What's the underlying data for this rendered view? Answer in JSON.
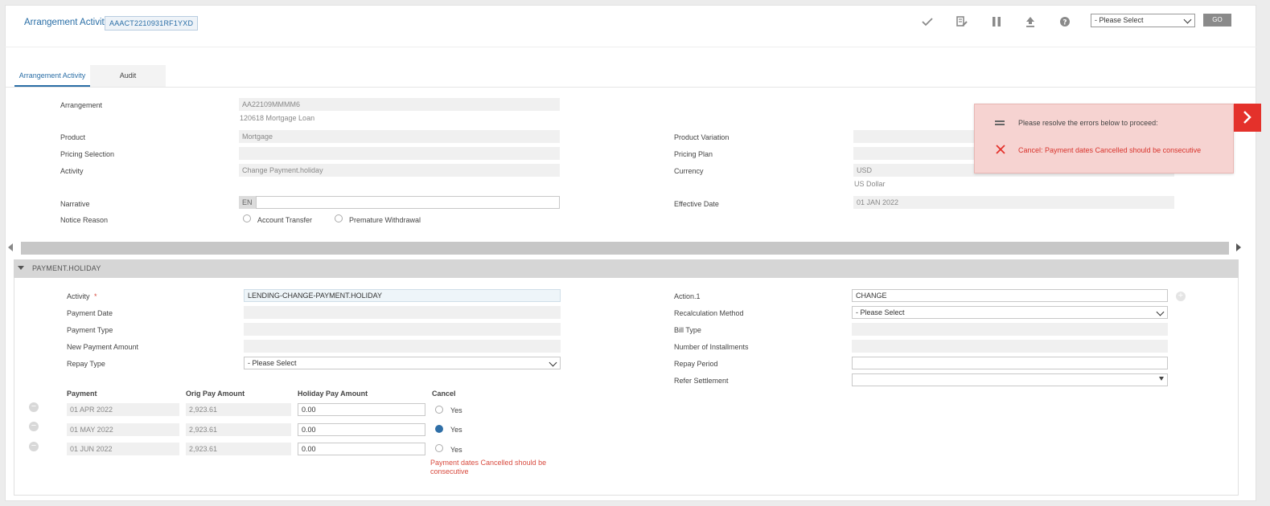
{
  "header": {
    "title": "Arrangement Activity",
    "id": "AAACT2210931RF1YXD",
    "toolbar_icons": [
      "check-icon",
      "edit-document-icon",
      "pause-icon",
      "upload-icon",
      "help-icon"
    ],
    "select_value": "- Please Select",
    "go_label": "GO"
  },
  "tabs": [
    "Arrangement Activity",
    "Audit"
  ],
  "arrangement": {
    "arrangement_label": "Arrangement",
    "arrangement_value": "AA22109MMMM6",
    "arrangement_sub": "120618 Mortgage Loan",
    "product_label": "Product",
    "product_value": "Mortgage",
    "pricing_selection_label": "Pricing Selection",
    "pricing_selection_value": "",
    "activity_label": "Activity",
    "activity_value": "Change Payment.holiday",
    "narrative_label": "Narrative",
    "narrative_lang": "EN",
    "narrative_value": "",
    "notice_reason_label": "Notice Reason",
    "notice_options": [
      "Account Transfer",
      "Premature Withdrawal"
    ],
    "product_variation_label": "Product Variation",
    "pricing_plan_label": "Pricing Plan",
    "currency_label": "Currency",
    "currency_value": "USD",
    "currency_sub": "US Dollar",
    "effective_date_label": "Effective Date",
    "effective_date_value": "01 JAN 2022"
  },
  "section": {
    "title": "PAYMENT.HOLIDAY",
    "activity_label": "Activity",
    "required_mark": "*",
    "activity_value": "LENDING-CHANGE-PAYMENT.HOLIDAY",
    "payment_date_label": "Payment Date",
    "payment_type_label": "Payment Type",
    "new_payment_amount_label": "New Payment Amount",
    "repay_type_label": "Repay Type",
    "repay_type_value": "- Please Select",
    "action_label": "Action.1",
    "action_value": "CHANGE",
    "recalc_label": "Recalculation Method",
    "recalc_value": "- Please Select",
    "bill_type_label": "Bill Type",
    "installments_label": "Number of Installments",
    "repay_period_label": "Repay Period",
    "refer_settlement_label": "Refer Settlement",
    "table": {
      "headers": [
        "Payment",
        "Orig Pay Amount",
        "Holiday Pay Amount",
        "Cancel"
      ],
      "rows": [
        {
          "payment": "01 APR 2022",
          "orig": "2,923.61",
          "holiday": "0.00",
          "cancel": "Yes",
          "checked": false
        },
        {
          "payment": "01 MAY 2022",
          "orig": "2,923.61",
          "holiday": "0.00",
          "cancel": "Yes",
          "checked": true
        },
        {
          "payment": "01 JUN 2022",
          "orig": "2,923.61",
          "holiday": "0.00",
          "cancel": "Yes",
          "checked": false
        }
      ]
    },
    "error_line1": "Payment dates Cancelled should be",
    "error_line2": "consecutive"
  },
  "toast": {
    "message": "Please resolve the errors below to proceed:",
    "error": "Cancel: Payment dates Cancelled should be consecutive",
    "color_bg": "#f6d3d1",
    "color_accent": "#e4312b"
  }
}
